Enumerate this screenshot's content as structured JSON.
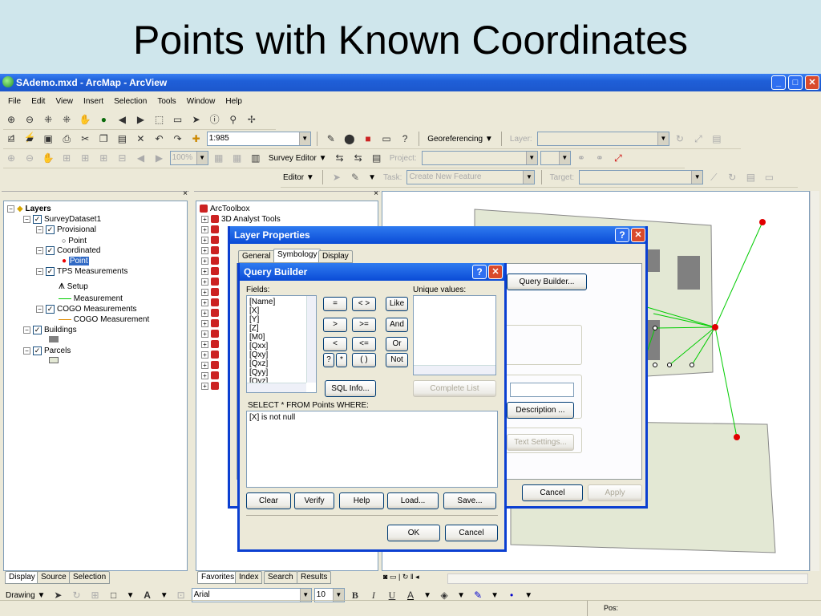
{
  "slide": {
    "title": "Points with Known Coordinates"
  },
  "window": {
    "title": "SAdemo.mxd - ArcMap - ArcView",
    "minimize": "_",
    "restore": "□",
    "close": "✕"
  },
  "menu": [
    "File",
    "Edit",
    "View",
    "Insert",
    "Selection",
    "Tools",
    "Window",
    "Help"
  ],
  "toolbar": {
    "scale": "1:985",
    "georeferencing": "Georeferencing ▼",
    "layer_label": "Layer:",
    "project_label": "Project:",
    "zoom_pct": "100%",
    "survey_editor": "Survey Editor ▼",
    "editor": "Editor ▼",
    "task_label": "Task:",
    "task_value": "Create New Feature",
    "target_label": "Target:"
  },
  "toc": {
    "root": "Layers",
    "items": [
      {
        "label": "SurveyDataset1"
      },
      {
        "label": "Provisional"
      },
      {
        "label": "Point"
      },
      {
        "label": "Coordinated"
      },
      {
        "label": "Point"
      },
      {
        "label": "TPS Measurements"
      },
      {
        "label": "Setup"
      },
      {
        "label": "Measurement"
      },
      {
        "label": "COGO Measurements"
      },
      {
        "label": "COGO Measurement"
      },
      {
        "label": "Buildings"
      },
      {
        "label": "Parcels"
      }
    ],
    "tabs": [
      "Display",
      "Source",
      "Selection"
    ]
  },
  "toolbox": {
    "root": "ArcToolbox",
    "first": "3D Analyst Tools",
    "tabs": [
      "Favorites",
      "Index",
      "Search",
      "Results"
    ]
  },
  "layer_props": {
    "title": "Layer Properties",
    "tabs": [
      "General",
      "Symbology",
      "Display"
    ],
    "query_builder_btn": "Query Builder...",
    "description_btn": "Description ...",
    "text_settings_btn": "Text Settings...",
    "cancel": "Cancel",
    "apply": "Apply"
  },
  "query_builder": {
    "title": "Query Builder",
    "fields_label": "Fields:",
    "fields": [
      "[Name]",
      "[X]",
      "[Y]",
      "[Z]",
      "[M0]",
      "[Qxx]",
      "[Qxy]",
      "[Qxz]",
      "[Qyy]",
      "[Qyz]"
    ],
    "unique_label": "Unique values:",
    "ops": [
      "=",
      "< >",
      "Like",
      ">",
      ">=",
      "And",
      "<",
      "<=",
      "Or",
      "?",
      "*",
      "( )",
      "Not"
    ],
    "sql_info": "SQL Info...",
    "complete_list": "Complete List",
    "select_text": "SELECT * FROM Points WHERE:",
    "expression": "[X] is not null",
    "clear": "Clear",
    "verify": "Verify",
    "help": "Help",
    "load": "Load...",
    "save": "Save...",
    "ok": "OK",
    "cancel": "Cancel"
  },
  "drawing": {
    "label": "Drawing ▼",
    "font": "Arial",
    "size": "10",
    "bold": "B",
    "italic": "I",
    "underline": "U",
    "font_color": "A"
  },
  "status": {
    "pos": "Pos:"
  },
  "colors": {
    "title_blue": "#1f5fd8",
    "point_red": "#e00000",
    "measure_green": "#00cc00",
    "building_gray": "#808080",
    "parcel_fill": "#e3e8d4"
  }
}
